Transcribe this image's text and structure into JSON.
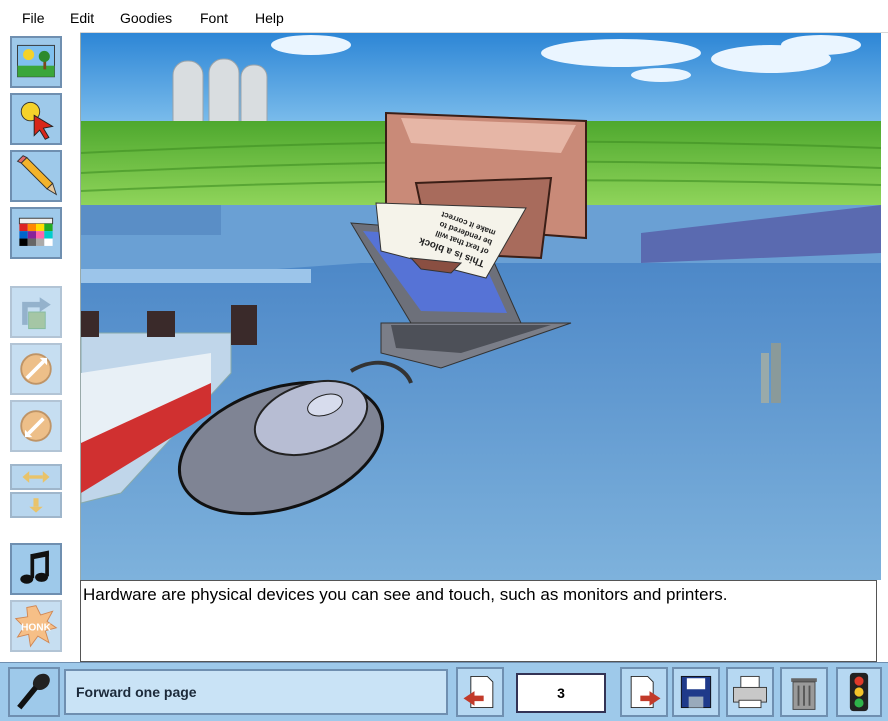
{
  "menu": {
    "items": [
      "File",
      "Edit",
      "Goodies",
      "Font",
      "Help"
    ]
  },
  "tools": {
    "main": [
      "background-tool",
      "select-tool",
      "pencil-tool",
      "color-palette-tool"
    ],
    "secondary": [
      "rotate-tool",
      "enlarge-tool",
      "shrink-tool",
      "flip-horizontal-tool",
      "flip-vertical-tool"
    ],
    "sound": [
      "music-tool",
      "honk-sound-tool",
      "microphone-tool"
    ]
  },
  "illustration": {
    "paper_text": [
      "This is a block",
      "of text that will",
      "be rendered to",
      "make it correct"
    ]
  },
  "caption": {
    "text": "Hardware are physical devices you can see and touch, such as monitors and printers."
  },
  "status": {
    "text": "Forward one page"
  },
  "page": {
    "number": "3"
  },
  "colors": {
    "toolbar_blue": "#9ec9ea",
    "status_blue": "#c9e3f6",
    "arrow_red": "#c23a2a"
  }
}
